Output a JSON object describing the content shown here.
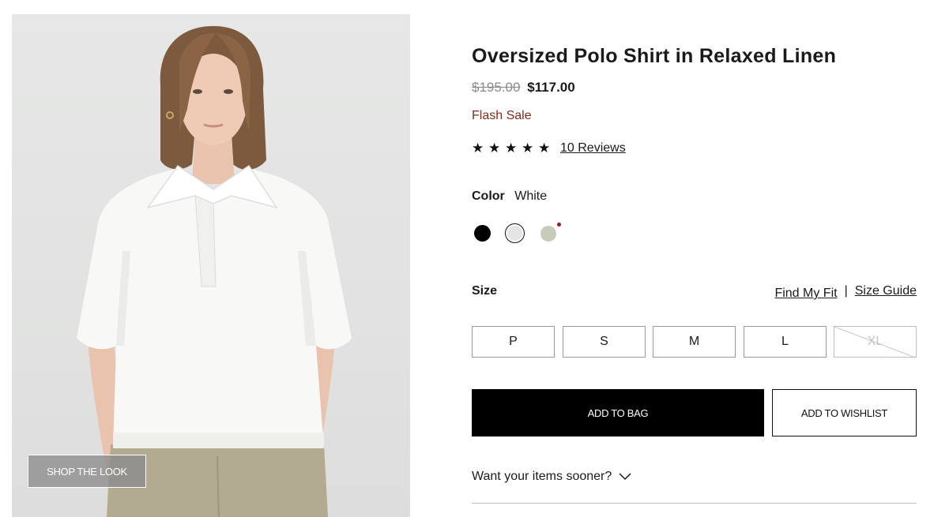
{
  "product": {
    "title": "Oversized Polo Shirt in Relaxed Linen",
    "price_original": "$195.00",
    "price_sale": "$117.00",
    "sale_label": "Flash Sale",
    "rating_stars": 5,
    "reviews_label": "10 Reviews",
    "image_alt": "Model wearing white oversized linen polo shirt"
  },
  "color": {
    "label": "Color",
    "selected": "White",
    "swatches": [
      {
        "name": "Black",
        "hex": "#000000"
      },
      {
        "name": "White",
        "hex": "#e5e5e5",
        "selected": true
      },
      {
        "name": "Sage",
        "hex": "#c8cbb9",
        "badge": true
      }
    ]
  },
  "size": {
    "label": "Size",
    "find_fit": "Find My Fit",
    "separator": "|",
    "guide": "Size Guide",
    "options": [
      {
        "label": "P",
        "available": true
      },
      {
        "label": "S",
        "available": true
      },
      {
        "label": "M",
        "available": true
      },
      {
        "label": "L",
        "available": true
      },
      {
        "label": "XL",
        "available": false
      }
    ]
  },
  "actions": {
    "shop_look": "SHOP THE LOOK",
    "add_to_bag": "ADD TO BAG",
    "add_to_wishlist": "ADD TO WISHLIST"
  },
  "delivery": {
    "label": "Want your items sooner?"
  },
  "icons": {
    "star": "star-icon",
    "chevron": "chevron-down-icon"
  },
  "colors": {
    "sale_red": "#8b2a1d",
    "badge_red": "#9a1d1d",
    "primary": "#000000"
  }
}
